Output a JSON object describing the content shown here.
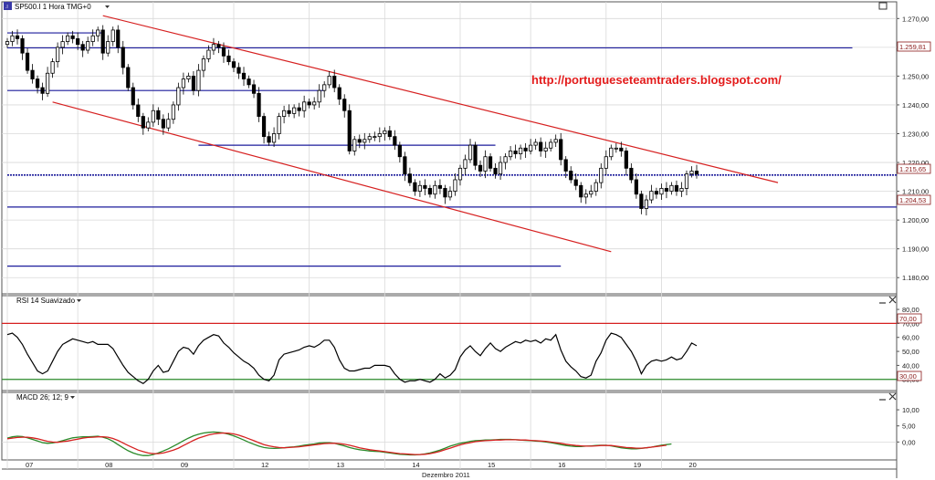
{
  "colors": {
    "background": "#ffffff",
    "grid": "#d9d9d9",
    "border": "#555555",
    "bull_candle": "#ffffff",
    "bear_candle": "#000000",
    "channel_line": "#d62020",
    "support_line": "#1c1c9c",
    "rsi_line": "#000000",
    "rsi_upper": "#d62020",
    "rsi_lower": "#2a8a2a",
    "macd_line": "#2a8a2a",
    "signal_line": "#d62020",
    "url_text": "#e31b1b"
  },
  "header": {
    "symbol_icon": "chart-symbol-icon",
    "title": "SP500.I 1 Hora TMG+0",
    "dropdown_icon": "chevron-down-icon",
    "maximize_icon": "maximize-icon"
  },
  "watermark_url": "http://portugueseteamtraders.blogspot.com/",
  "x_axis": {
    "label": "Dezembro 2011",
    "days": [
      "07",
      "08",
      "09",
      "12",
      "13",
      "14",
      "15",
      "16",
      "19",
      "20"
    ]
  },
  "price_labels": {
    "upper_level": "1.259,81",
    "last_price": "1.215,65",
    "lower_level": "1.204,53"
  },
  "rsi_panel": {
    "title": "RSI 14 Suavizado",
    "dropdown_icon": "chevron-down-icon",
    "minimize_icon": "minimize-icon",
    "close_icon": "close-icon",
    "ticks": [
      "80,00",
      "70,00",
      "60,00",
      "50,00",
      "40,00",
      "30,00"
    ],
    "upper_label": "70,00",
    "lower_label": "30,00"
  },
  "macd_panel": {
    "title": "MACD 26; 12; 9",
    "dropdown_icon": "chevron-down-icon",
    "minimize_icon": "minimize-icon",
    "close_icon": "close-icon",
    "ticks": [
      "10,00",
      "5,00",
      "0,00"
    ]
  },
  "chart_data": [
    {
      "type": "candlestick",
      "title": "SP500.I 1 Hora TMG+0",
      "xlabel": "Dezembro 2011",
      "days": [
        "07",
        "08",
        "09",
        "12",
        "13",
        "14",
        "15",
        "16",
        "19",
        "20"
      ],
      "ylim": [
        1175,
        1272
      ],
      "yticks": [
        "1.270,00",
        "1.260,00",
        "1.250,00",
        "1.240,00",
        "1.230,00",
        "1.220,00",
        "1.210,00",
        "1.200,00",
        "1.190,00",
        "1.180,00"
      ],
      "horizontal_levels": [
        1265,
        1259.81,
        1245,
        1226,
        1215.65,
        1204.53,
        1184
      ],
      "last_price": 1215.65,
      "closes": [
        1262,
        1264,
        1263,
        1258,
        1252,
        1249,
        1246,
        1244,
        1251,
        1255,
        1260,
        1262,
        1264,
        1263,
        1261,
        1259,
        1262,
        1264,
        1266,
        1258,
        1262,
        1266,
        1260,
        1253,
        1246,
        1240,
        1236,
        1232,
        1234,
        1238,
        1235,
        1232,
        1235,
        1240,
        1246,
        1249,
        1250,
        1245,
        1252,
        1256,
        1259,
        1261,
        1260,
        1257,
        1255,
        1253,
        1251,
        1249,
        1247,
        1244,
        1236,
        1229,
        1227,
        1230,
        1236,
        1238,
        1237,
        1239,
        1238,
        1241,
        1240,
        1241,
        1245,
        1247,
        1250,
        1246,
        1242,
        1238,
        1224,
        1228,
        1227,
        1228,
        1229,
        1229,
        1230,
        1231,
        1229,
        1226,
        1222,
        1216,
        1213,
        1210,
        1212,
        1211,
        1209,
        1212,
        1211,
        1208,
        1210,
        1214,
        1218,
        1221,
        1226,
        1219,
        1217,
        1222,
        1218,
        1216,
        1220,
        1222,
        1224,
        1223,
        1225,
        1224,
        1226,
        1227,
        1224,
        1225,
        1227,
        1228,
        1221,
        1217,
        1214,
        1212,
        1208,
        1209,
        1210,
        1213,
        1218,
        1222,
        1225,
        1225,
        1224,
        1218,
        1214,
        1209,
        1204,
        1207,
        1210,
        1209,
        1211,
        1210,
        1212,
        1210,
        1211,
        1216,
        1217,
        1216
      ]
    },
    {
      "type": "line",
      "title": "RSI 14 Suavizado",
      "ylim": [
        22,
        82
      ],
      "yticks": [
        "80,00",
        "70,00",
        "60,00",
        "50,00",
        "40,00",
        "30,00"
      ],
      "upper_band": 70,
      "lower_band": 30,
      "values": [
        62,
        63,
        60,
        55,
        48,
        42,
        36,
        34,
        36,
        43,
        50,
        55,
        57,
        59,
        58,
        57,
        56,
        57,
        55,
        55,
        55,
        52,
        46,
        40,
        35,
        32,
        29,
        27,
        30,
        36,
        40,
        35,
        36,
        43,
        50,
        53,
        52,
        48,
        54,
        58,
        60,
        62,
        61,
        56,
        53,
        49,
        46,
        43,
        41,
        38,
        33,
        30,
        29,
        33,
        44,
        48,
        49,
        50,
        51,
        53,
        54,
        53,
        55,
        58,
        58,
        53,
        44,
        38,
        36,
        36,
        37,
        38,
        38,
        40,
        40,
        40,
        39,
        34,
        30,
        28,
        29,
        29,
        30,
        29,
        28,
        30,
        34,
        31,
        33,
        37,
        46,
        51,
        54,
        50,
        47,
        52,
        56,
        52,
        50,
        53,
        55,
        57,
        56,
        58,
        57,
        58,
        56,
        59,
        58,
        62,
        51,
        43,
        39,
        36,
        32,
        31,
        33,
        43,
        49,
        58,
        63,
        62,
        60,
        55,
        50,
        43,
        34,
        40,
        43,
        44,
        43,
        44,
        46,
        44,
        45,
        50,
        56,
        54
      ]
    },
    {
      "type": "line",
      "title": "MACD 26; 12; 9",
      "ylim": [
        -5,
        12
      ],
      "yticks": [
        "10,00",
        "5,00",
        "0,00"
      ],
      "series": [
        {
          "values": [
            1.2,
            1.6,
            1.8,
            1.7,
            1.3,
            0.8,
            0.3,
            -0.2,
            -0.4,
            -0.3,
            0.0,
            0.4,
            0.9,
            1.3,
            1.5,
            1.6,
            1.6,
            1.7,
            1.8,
            1.5,
            1.0,
            0.2,
            -0.8,
            -1.8,
            -2.7,
            -3.4,
            -3.9,
            -4.2,
            -4.2,
            -3.9,
            -3.4,
            -2.8,
            -2.1,
            -1.3,
            -0.5,
            0.4,
            1.2,
            1.9,
            2.4,
            2.8,
            3.0,
            3.1,
            3.0,
            2.8,
            2.4,
            1.9,
            1.3,
            0.6,
            -0.1,
            -0.7,
            -1.3,
            -1.7,
            -1.9,
            -2.0,
            -1.9,
            -1.8,
            -1.6,
            -1.5,
            -1.3,
            -1.0,
            -0.8,
            -0.6,
            -0.3,
            -0.2,
            -0.2,
            -0.4,
            -0.8,
            -1.2,
            -1.7,
            -2.1,
            -2.4,
            -2.6,
            -2.8,
            -2.9,
            -3.0,
            -3.2,
            -3.4,
            -3.6,
            -3.8,
            -3.9,
            -4.0,
            -4.0,
            -3.9,
            -3.7,
            -3.4,
            -3.0,
            -2.5,
            -1.9,
            -1.3,
            -0.8,
            -0.4,
            -0.1,
            0.2,
            0.4,
            0.5,
            0.6,
            0.6,
            0.7,
            0.8,
            0.8,
            0.8,
            0.7,
            0.6,
            0.5,
            0.4,
            0.3,
            0.2,
            0.0,
            -0.2,
            -0.5,
            -0.8,
            -1.1,
            -1.3,
            -1.4,
            -1.4,
            -1.3,
            -1.2,
            -1.1,
            -1.0,
            -1.0,
            -1.2,
            -1.5,
            -1.8,
            -2.0,
            -2.1,
            -2.1,
            -2.0,
            -1.8,
            -1.6,
            -1.3,
            -1.0,
            -0.8,
            -0.6
          ]
        },
        {
          "values": [
            1.0,
            1.2,
            1.4,
            1.5,
            1.5,
            1.3,
            1.0,
            0.6,
            0.2,
            0.0,
            -0.1,
            0.1,
            0.3,
            0.6,
            0.9,
            1.2,
            1.4,
            1.5,
            1.6,
            1.6,
            1.5,
            1.1,
            0.5,
            -0.3,
            -1.1,
            -1.8,
            -2.5,
            -3.0,
            -3.4,
            -3.6,
            -3.6,
            -3.4,
            -3.0,
            -2.5,
            -1.9,
            -1.1,
            -0.3,
            0.5,
            1.2,
            1.7,
            2.2,
            2.5,
            2.7,
            2.8,
            2.7,
            2.5,
            2.1,
            1.6,
            1.0,
            0.4,
            -0.2,
            -0.8,
            -1.2,
            -1.5,
            -1.7,
            -1.8,
            -1.7,
            -1.6,
            -1.5,
            -1.3,
            -1.1,
            -0.9,
            -0.7,
            -0.5,
            -0.4,
            -0.4,
            -0.5,
            -0.7,
            -1.0,
            -1.4,
            -1.8,
            -2.1,
            -2.4,
            -2.6,
            -2.8,
            -3.0,
            -3.2,
            -3.4,
            -3.6,
            -3.7,
            -3.8,
            -3.9,
            -3.9,
            -3.8,
            -3.6,
            -3.3,
            -2.9,
            -2.4,
            -1.9,
            -1.4,
            -0.9,
            -0.5,
            -0.2,
            0.1,
            0.3,
            0.4,
            0.5,
            0.6,
            0.6,
            0.7,
            0.7,
            0.7,
            0.6,
            0.6,
            0.5,
            0.4,
            0.3,
            0.2,
            0.0,
            -0.2,
            -0.4,
            -0.7,
            -0.9,
            -1.1,
            -1.2,
            -1.3,
            -1.3,
            -1.2,
            -1.1,
            -1.1,
            -1.1,
            -1.3,
            -1.5,
            -1.7,
            -1.8,
            -1.9,
            -1.9,
            -1.8,
            -1.6,
            -1.4,
            -1.2,
            -1.0
          ]
        }
      ]
    }
  ]
}
